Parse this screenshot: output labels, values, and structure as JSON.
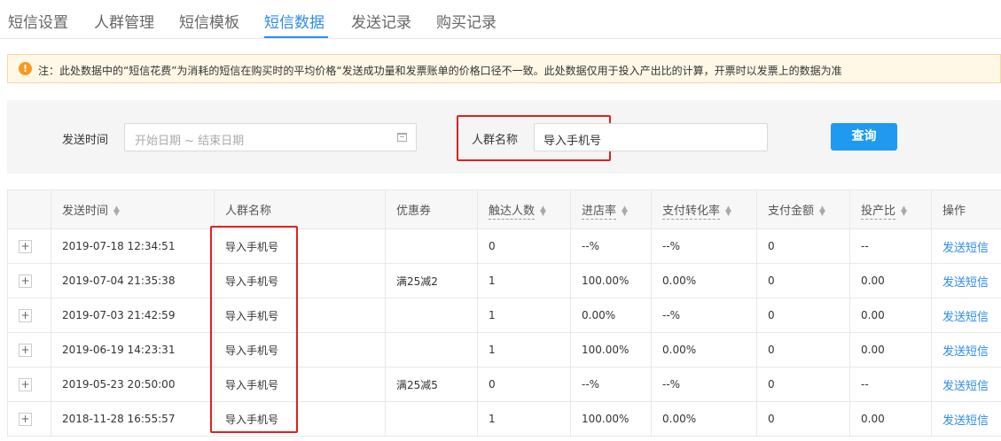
{
  "tabs": [
    {
      "label": "短信设置",
      "active": false
    },
    {
      "label": "人群管理",
      "active": false
    },
    {
      "label": "短信模板",
      "active": false
    },
    {
      "label": "短信数据",
      "active": true
    },
    {
      "label": "发送记录",
      "active": false
    },
    {
      "label": "购买记录",
      "active": false
    }
  ],
  "notice": {
    "icon": "warning-icon",
    "text": "注：此处数据中的“短信花费”为消耗的短信在购买时的平均价格“发送成功量和发票账单的价格口径不一致。此处数据仅用于投入产出比的计算，开票时以发票上的数据为准"
  },
  "filter": {
    "send_time_label": "发送时间",
    "date_placeholder": "开始日期 ~ 结束日期",
    "crowd_name_label": "人群名称",
    "crowd_name_value": "导入手机号",
    "query_button": "查询"
  },
  "table": {
    "columns": [
      "",
      "发送时间",
      "人群名称",
      "优惠券",
      "触达人数",
      "进店率",
      "支付转化率",
      "支付金额",
      "投产比",
      "操作"
    ],
    "rows": [
      {
        "send_time": "2019-07-18 12:34:51",
        "crowd_name": "导入手机号",
        "coupon": "",
        "reach": "0",
        "visit_rate": "--%",
        "pay_conversion": "--%",
        "pay_amount": "0",
        "roi": "--",
        "action": "发送短信"
      },
      {
        "send_time": "2019-07-04 21:35:38",
        "crowd_name": "导入手机号",
        "coupon": "满25减2",
        "reach": "1",
        "visit_rate": "100.00%",
        "pay_conversion": "0.00%",
        "pay_amount": "0",
        "roi": "0.00",
        "action": "发送短信"
      },
      {
        "send_time": "2019-07-03 21:42:59",
        "crowd_name": "导入手机号",
        "coupon": "",
        "reach": "1",
        "visit_rate": "0.00%",
        "pay_conversion": "--%",
        "pay_amount": "0",
        "roi": "0.00",
        "action": "发送短信"
      },
      {
        "send_time": "2019-06-19 14:23:31",
        "crowd_name": "导入手机号",
        "coupon": "",
        "reach": "1",
        "visit_rate": "100.00%",
        "pay_conversion": "0.00%",
        "pay_amount": "0",
        "roi": "0.00",
        "action": "发送短信"
      },
      {
        "send_time": "2019-05-23 20:50:00",
        "crowd_name": "导入手机号",
        "coupon": "满25减5",
        "reach": "0",
        "visit_rate": "--%",
        "pay_conversion": "--%",
        "pay_amount": "0",
        "roi": "--",
        "action": "发送短信"
      },
      {
        "send_time": "2018-11-28 16:55:57",
        "crowd_name": "导入手机号",
        "coupon": "",
        "reach": "1",
        "visit_rate": "100.00%",
        "pay_conversion": "0.00%",
        "pay_amount": "0",
        "roi": "0.00",
        "action": "发送短信"
      }
    ]
  },
  "colors": {
    "accent": "#2d8cf0",
    "button": "#1e9bf0",
    "highlight": "#e02020",
    "warning": "#f59a23"
  }
}
